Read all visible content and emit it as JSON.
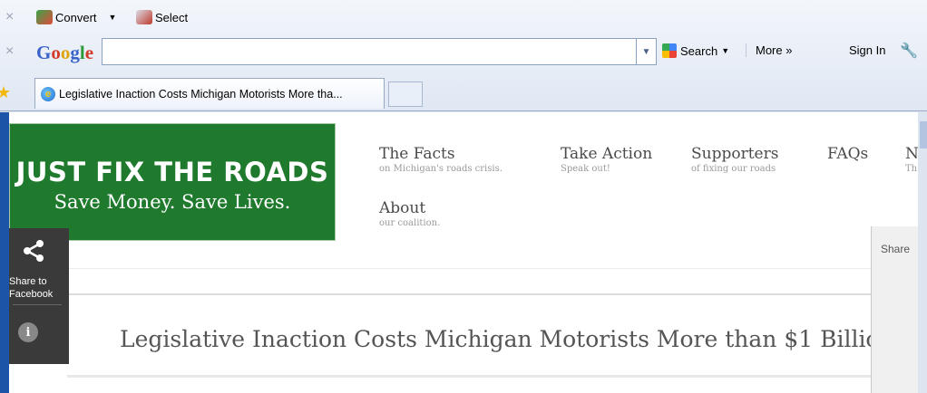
{
  "toolbar1": {
    "convert_label": "Convert",
    "select_label": "Select"
  },
  "google_toolbar": {
    "logo": "Google",
    "search_value": "",
    "search_label": "Search",
    "more_label": "More »",
    "signin_label": "Sign In"
  },
  "tabs": [
    {
      "label": "Legislative Inaction Costs Michigan Motorists More tha..."
    }
  ],
  "site": {
    "logo_title": "JUST FIX THE ROADS",
    "logo_tagline": "Save Money. Save Lives.",
    "nav": [
      {
        "label": "The Facts",
        "sub": "on Michigan's roads crisis."
      },
      {
        "label": "Take Action",
        "sub": "Speak out!"
      },
      {
        "label": "Supporters",
        "sub": "of fixing our roads"
      },
      {
        "label": "FAQs",
        "sub": ""
      },
      {
        "label": "N",
        "sub": "Th"
      },
      {
        "label": "About",
        "sub": "our coalition."
      }
    ],
    "share_sidebar": {
      "label": "Share to Facebook",
      "info": "i"
    },
    "share_panel_label": "Share",
    "headline": "Legislative Inaction Costs Michigan Motorists More than $1 Billio"
  }
}
